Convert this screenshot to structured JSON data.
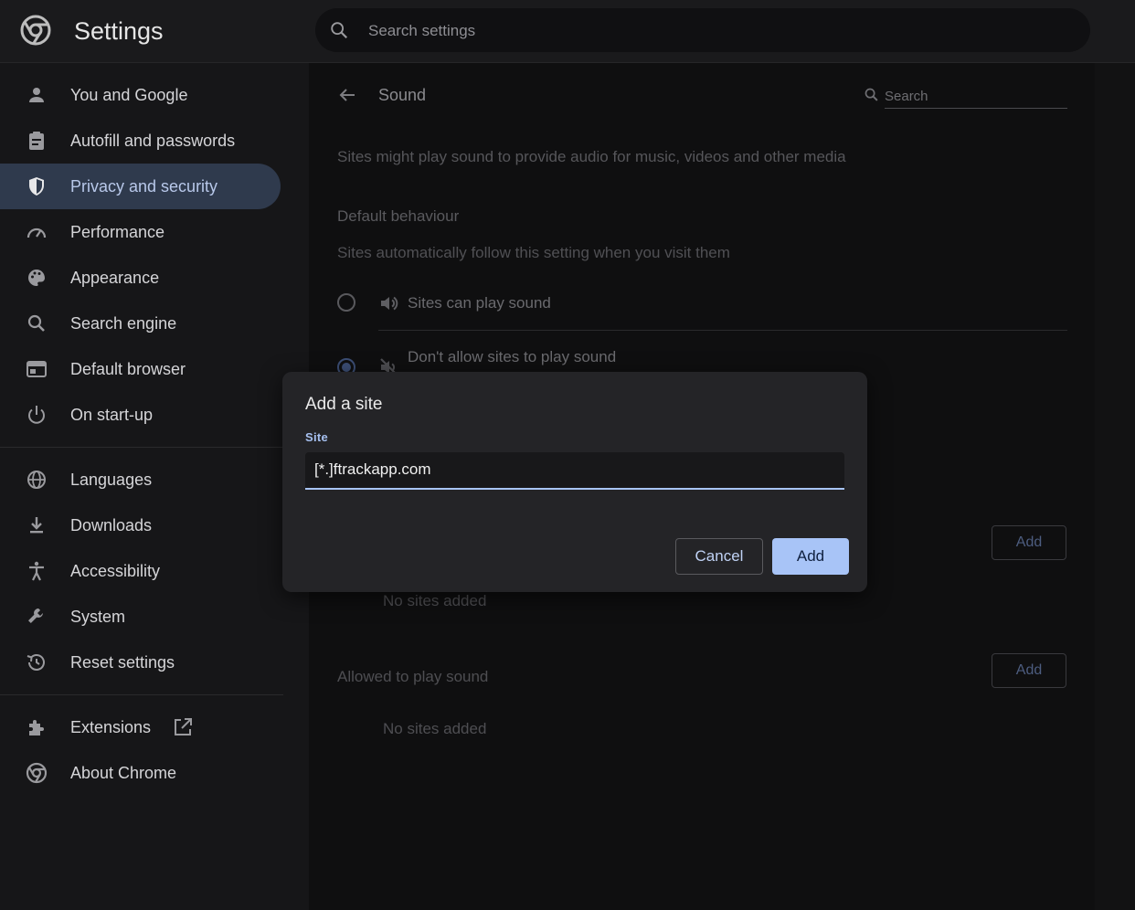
{
  "header": {
    "title": "Settings",
    "search_placeholder": "Search settings"
  },
  "sidebar": {
    "items": [
      {
        "label": "You and Google",
        "icon": "person-icon"
      },
      {
        "label": "Autofill and passwords",
        "icon": "clipboard-icon"
      },
      {
        "label": "Privacy and security",
        "icon": "shield-icon",
        "active": true
      },
      {
        "label": "Performance",
        "icon": "speedometer-icon"
      },
      {
        "label": "Appearance",
        "icon": "palette-icon"
      },
      {
        "label": "Search engine",
        "icon": "search-icon"
      },
      {
        "label": "Default browser",
        "icon": "browser-window-icon"
      },
      {
        "label": "On start-up",
        "icon": "power-icon"
      },
      {
        "label": "Languages",
        "icon": "globe-icon"
      },
      {
        "label": "Downloads",
        "icon": "download-icon"
      },
      {
        "label": "Accessibility",
        "icon": "accessibility-icon"
      },
      {
        "label": "System",
        "icon": "wrench-icon"
      },
      {
        "label": "Reset settings",
        "icon": "history-icon"
      },
      {
        "label": "Extensions",
        "icon": "puzzle-icon"
      },
      {
        "label": "About Chrome",
        "icon": "chrome-logo-icon"
      }
    ]
  },
  "main": {
    "title": "Sound",
    "search_placeholder": "Search",
    "description": "Sites might play sound to provide audio for music, videos and other media",
    "default_heading": "Default behaviour",
    "default_sub": "Sites automatically follow this setting when you visit them",
    "options": [
      {
        "label": "Sites can play sound",
        "checked": false
      },
      {
        "label": "Don't allow sites to play sound",
        "checked": true
      }
    ],
    "blocked": {
      "add_label": "Add",
      "empty": "No sites added"
    },
    "allowed": {
      "heading": "Allowed to play sound",
      "add_label": "Add",
      "empty": "No sites added"
    }
  },
  "dialog": {
    "title": "Add a site",
    "field_label": "Site",
    "field_value": "[*.]ftrackapp.com",
    "cancel_label": "Cancel",
    "add_label": "Add"
  },
  "colors": {
    "accent": "#a8c4f7",
    "active_nav_bg": "#2f3a4d",
    "dialog_bg": "#242427"
  }
}
